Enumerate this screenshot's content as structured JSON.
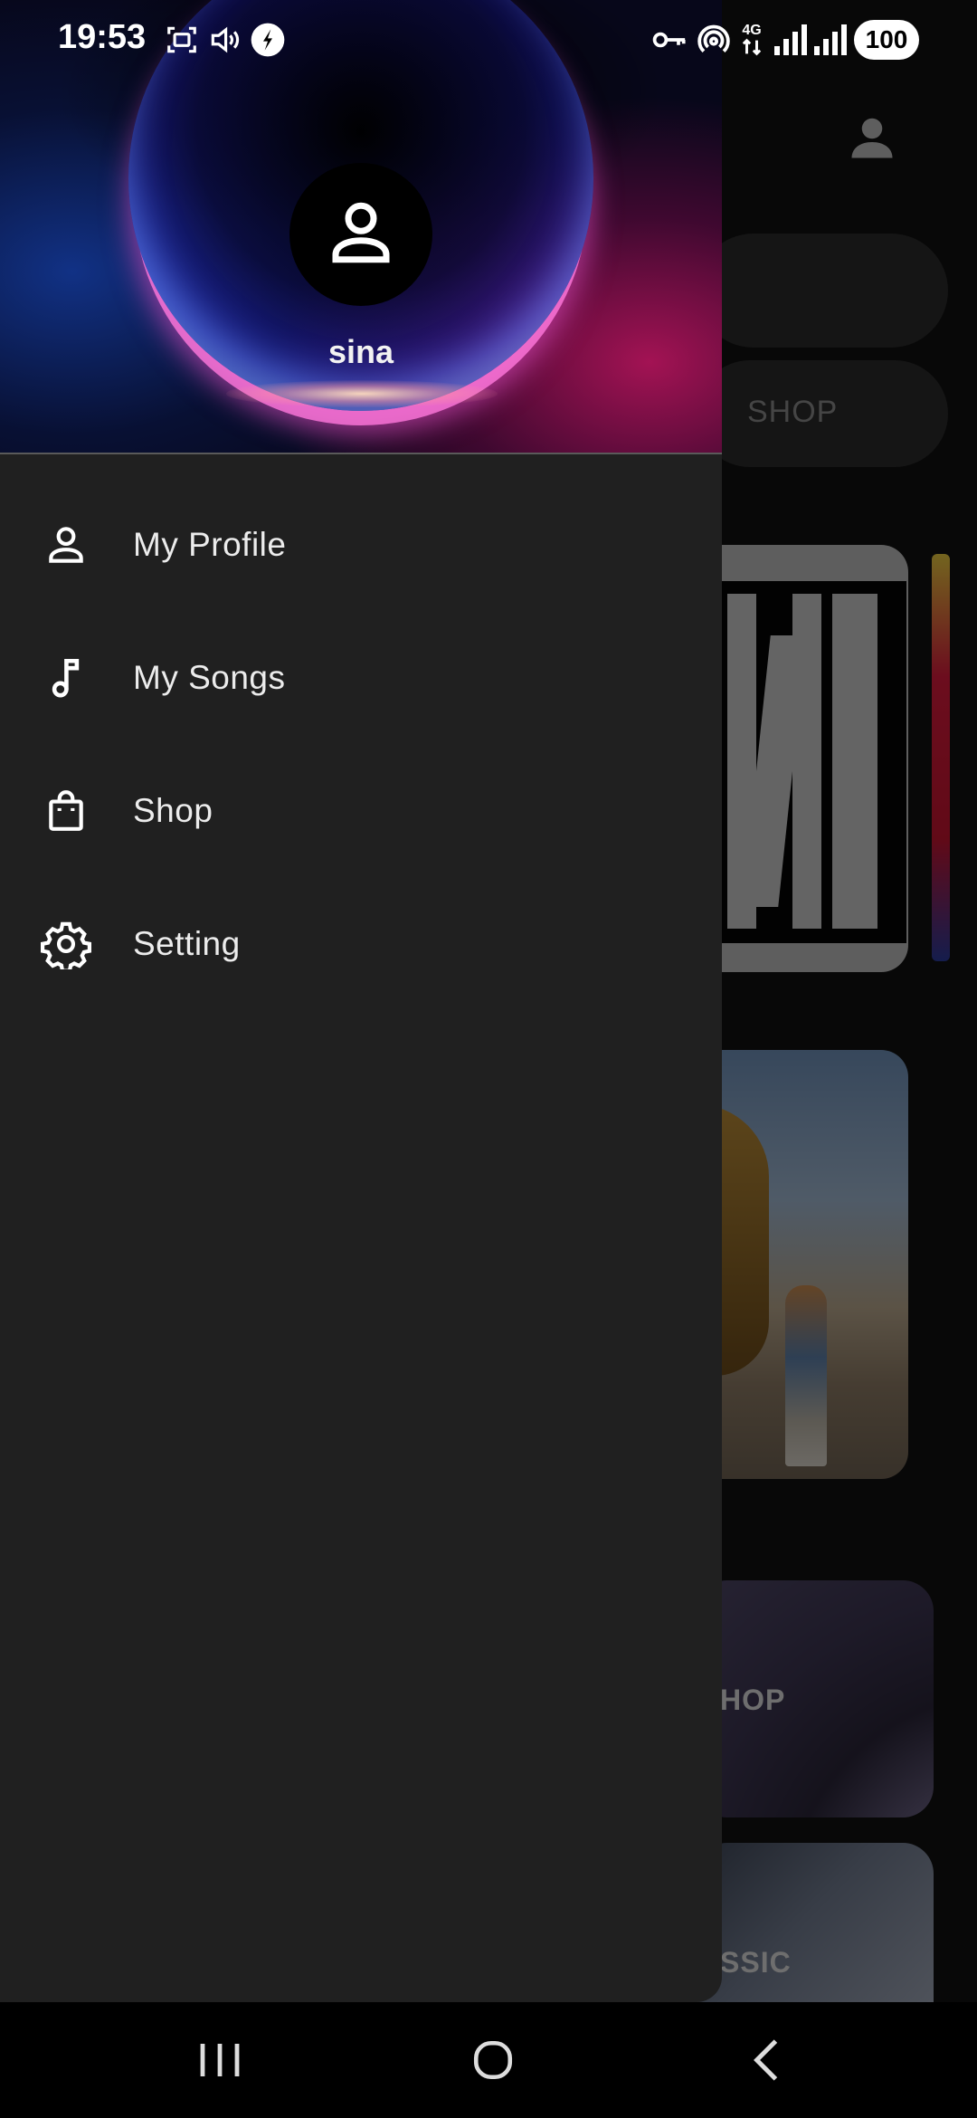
{
  "status_bar": {
    "time": "19:53",
    "network": "4G",
    "battery": "100",
    "icons": [
      "screenshot-icon",
      "vibrate-icon",
      "app-notification-icon",
      "vpn-key-icon",
      "hotspot-icon",
      "data-arrows-icon",
      "signal-icon",
      "signal-icon",
      "battery-icon"
    ]
  },
  "background": {
    "tabs_label": "SHOP",
    "card1_label": "HOP",
    "card2_label": "SSIC"
  },
  "drawer": {
    "username": "sina",
    "menu": [
      {
        "label": "My Profile",
        "icon": "person-icon"
      },
      {
        "label": "My Songs",
        "icon": "music-note-icon"
      },
      {
        "label": "Shop",
        "icon": "shopping-bag-icon"
      },
      {
        "label": "Setting",
        "icon": "gear-icon"
      }
    ]
  },
  "nav_bar": {
    "buttons": [
      "recent-apps-icon",
      "home-icon",
      "back-icon"
    ]
  },
  "colors": {
    "drawer_bg": "#202020",
    "app_bg": "#101010",
    "text": "#ececec"
  }
}
